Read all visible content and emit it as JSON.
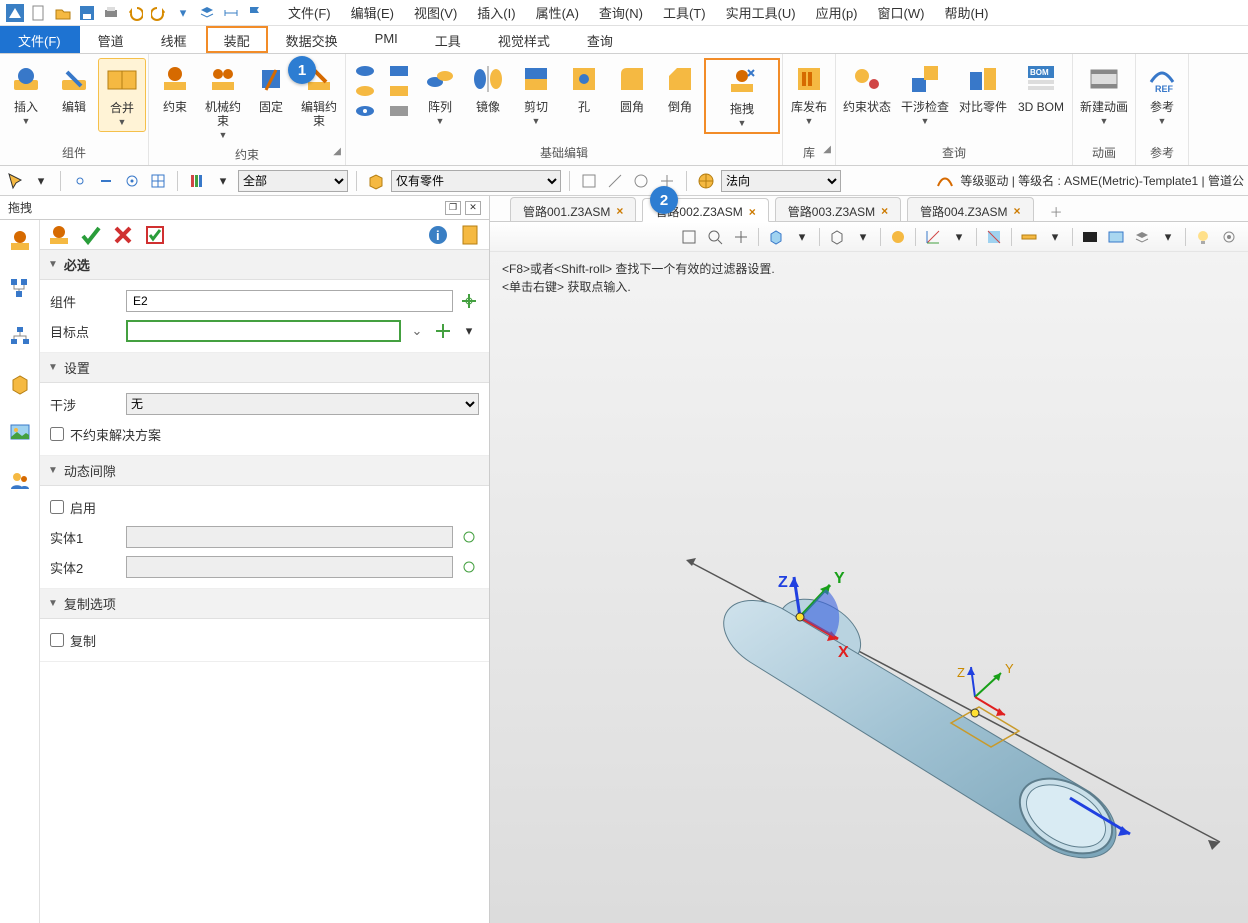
{
  "menubar": {
    "items": [
      "文件(F)",
      "编辑(E)",
      "视图(V)",
      "插入(I)",
      "属性(A)",
      "查询(N)",
      "工具(T)",
      "实用工具(U)",
      "应用(p)",
      "窗口(W)",
      "帮助(H)"
    ]
  },
  "ribbonTabs": [
    "文件(F)",
    "管道",
    "线框",
    "装配",
    "数据交换",
    "PMI",
    "工具",
    "视觉样式",
    "查询"
  ],
  "ribbonTabActive": 0,
  "ribbonTabHighlightIndex": 3,
  "stepBadges": {
    "one": "1",
    "two": "2"
  },
  "ribbon": {
    "groups": [
      {
        "label": "组件",
        "buttons": [
          {
            "name": "insert",
            "label": "插入",
            "drop": true
          },
          {
            "name": "edit",
            "label": "编辑",
            "drop": false
          },
          {
            "name": "merge",
            "label": "合并",
            "drop": true,
            "sel": true
          }
        ]
      },
      {
        "label": "约束",
        "expander": true,
        "buttons": [
          {
            "name": "constraint",
            "label": "约束",
            "drop": false
          },
          {
            "name": "mech-constraint",
            "label": "机械约束",
            "drop": true
          },
          {
            "name": "fix",
            "label": "固定",
            "drop": false
          },
          {
            "name": "edit-constraint",
            "label": "编辑约束",
            "drop": false
          }
        ]
      },
      {
        "label": "基础编辑",
        "buttons": [
          {
            "name": "pattern",
            "label": "阵列",
            "drop": true
          },
          {
            "name": "mirror",
            "label": "镜像",
            "drop": false
          },
          {
            "name": "cut",
            "label": "剪切",
            "drop": true
          },
          {
            "name": "hole",
            "label": "孔",
            "drop": false
          },
          {
            "name": "fillet",
            "label": "圆角",
            "drop": false
          },
          {
            "name": "chamfer",
            "label": "倒角",
            "drop": false
          },
          {
            "name": "drag",
            "label": "拖拽",
            "drop": true,
            "highlight": true
          }
        ]
      },
      {
        "label": "库",
        "expander": true,
        "buttons": [
          {
            "name": "lib-publish",
            "label": "库发布",
            "drop": true
          }
        ]
      },
      {
        "label": "查询",
        "buttons": [
          {
            "name": "constraint-state",
            "label": "约束状态",
            "drop": false
          },
          {
            "name": "interference",
            "label": "干涉检查",
            "drop": true
          },
          {
            "name": "compare",
            "label": "对比零件",
            "drop": false
          },
          {
            "name": "3dbom",
            "label": "3D BOM",
            "drop": false
          }
        ]
      },
      {
        "label": "动画",
        "buttons": [
          {
            "name": "new-anim",
            "label": "新建动画",
            "drop": true
          }
        ]
      },
      {
        "label": "参考",
        "buttons": [
          {
            "name": "reference",
            "label": "参考",
            "drop": true
          }
        ]
      }
    ]
  },
  "toolbar2": {
    "select1": {
      "value": "全部"
    },
    "select2": {
      "value": "仅有零件"
    },
    "select3": {
      "value": "法向"
    },
    "status": "等级驱动 | 等级名 : ASME(Metric)-Template1 | 管道公"
  },
  "panel": {
    "title": "拖拽",
    "sections": {
      "required": {
        "title": "必选",
        "component_label": "组件",
        "component_value": "E2",
        "target_label": "目标点",
        "target_value": ""
      },
      "settings": {
        "title": "设置",
        "interf_label": "干涉",
        "interf_value": "无",
        "unconstrained_label": "不约束解决方案"
      },
      "gap": {
        "title": "动态间隙",
        "enable_label": "启用",
        "body1_label": "实体1",
        "body1_value": "",
        "body2_label": "实体2",
        "body2_value": ""
      },
      "copy": {
        "title": "复制选项",
        "copy_label": "复制"
      }
    }
  },
  "docTabs": [
    {
      "label": "管路001.Z3ASM",
      "active": false
    },
    {
      "label": "管路002.Z3ASM",
      "active": true
    },
    {
      "label": "管路003.Z3ASM",
      "active": false
    },
    {
      "label": "管路004.Z3ASM",
      "active": false
    }
  ],
  "viewportHint": {
    "line1": "<F8>或者<Shift-roll> 查找下一个有效的过滤器设置.",
    "line2": "<单击右键> 获取点输入."
  },
  "axisLabels": {
    "x": "X",
    "y": "Y",
    "z": "Z"
  }
}
